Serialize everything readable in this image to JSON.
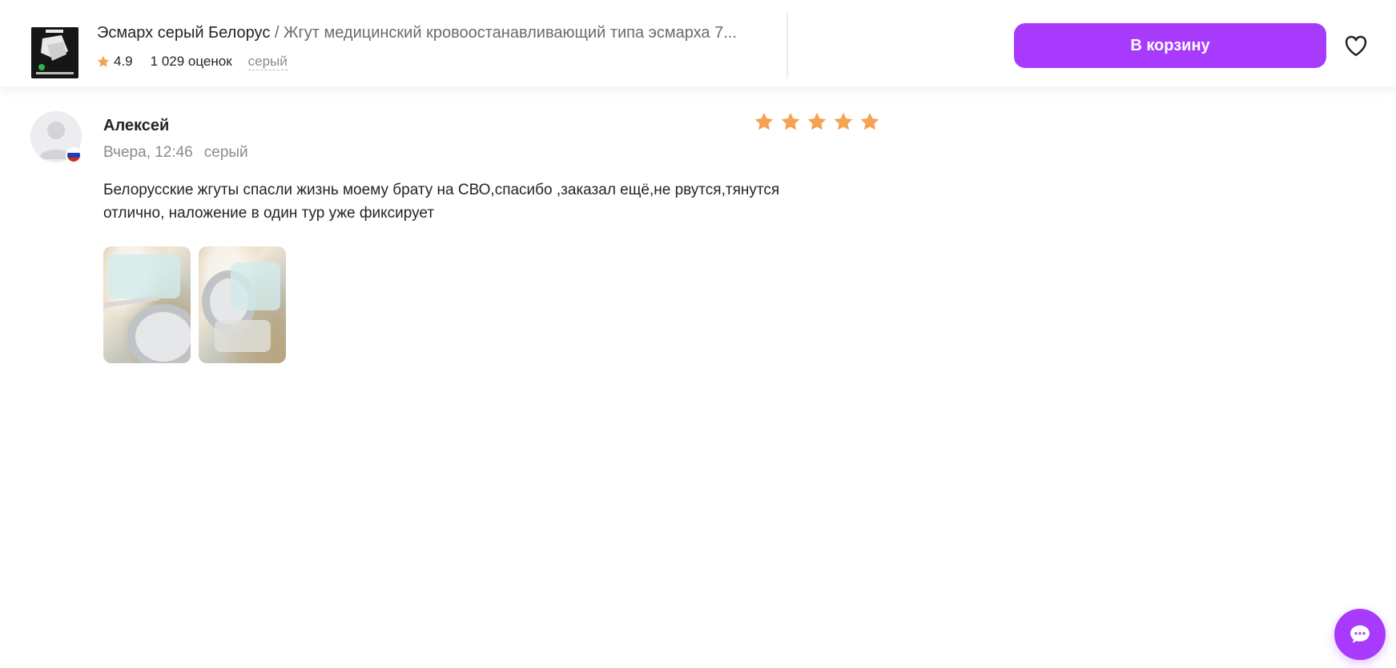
{
  "product": {
    "brand": "Эсмарх серый Белорус",
    "separator": " / ",
    "name": "Жгут медицинский кровоостанавливающий типа эсмарха 7...",
    "rating": "4.9",
    "rating_count": "1 029 оценок",
    "color": "серый",
    "cart_button_label": "В корзину"
  },
  "review": {
    "author": "Алексей",
    "date": "Вчера, 12:46",
    "variant": "серый",
    "stars": 5,
    "stars_max": 5,
    "text_line1": "Белорусские жгуты спасли жизнь моему брату на СВО,спасибо ,заказал ещё,не рвутся,тянутся",
    "text_line2": "отлично, наложение в один тур уже фиксирует",
    "photos": [
      {
        "icon": "review-photo"
      },
      {
        "icon": "review-photo"
      }
    ]
  },
  "colors": {
    "accent": "#a73afd",
    "star": "#f5a253",
    "muted_text": "#8b8b8b"
  },
  "icons": {
    "favorite": "heart-icon",
    "rating_star": "star-icon",
    "chat": "chat-icon",
    "country_flag": "russia-flag-icon"
  }
}
